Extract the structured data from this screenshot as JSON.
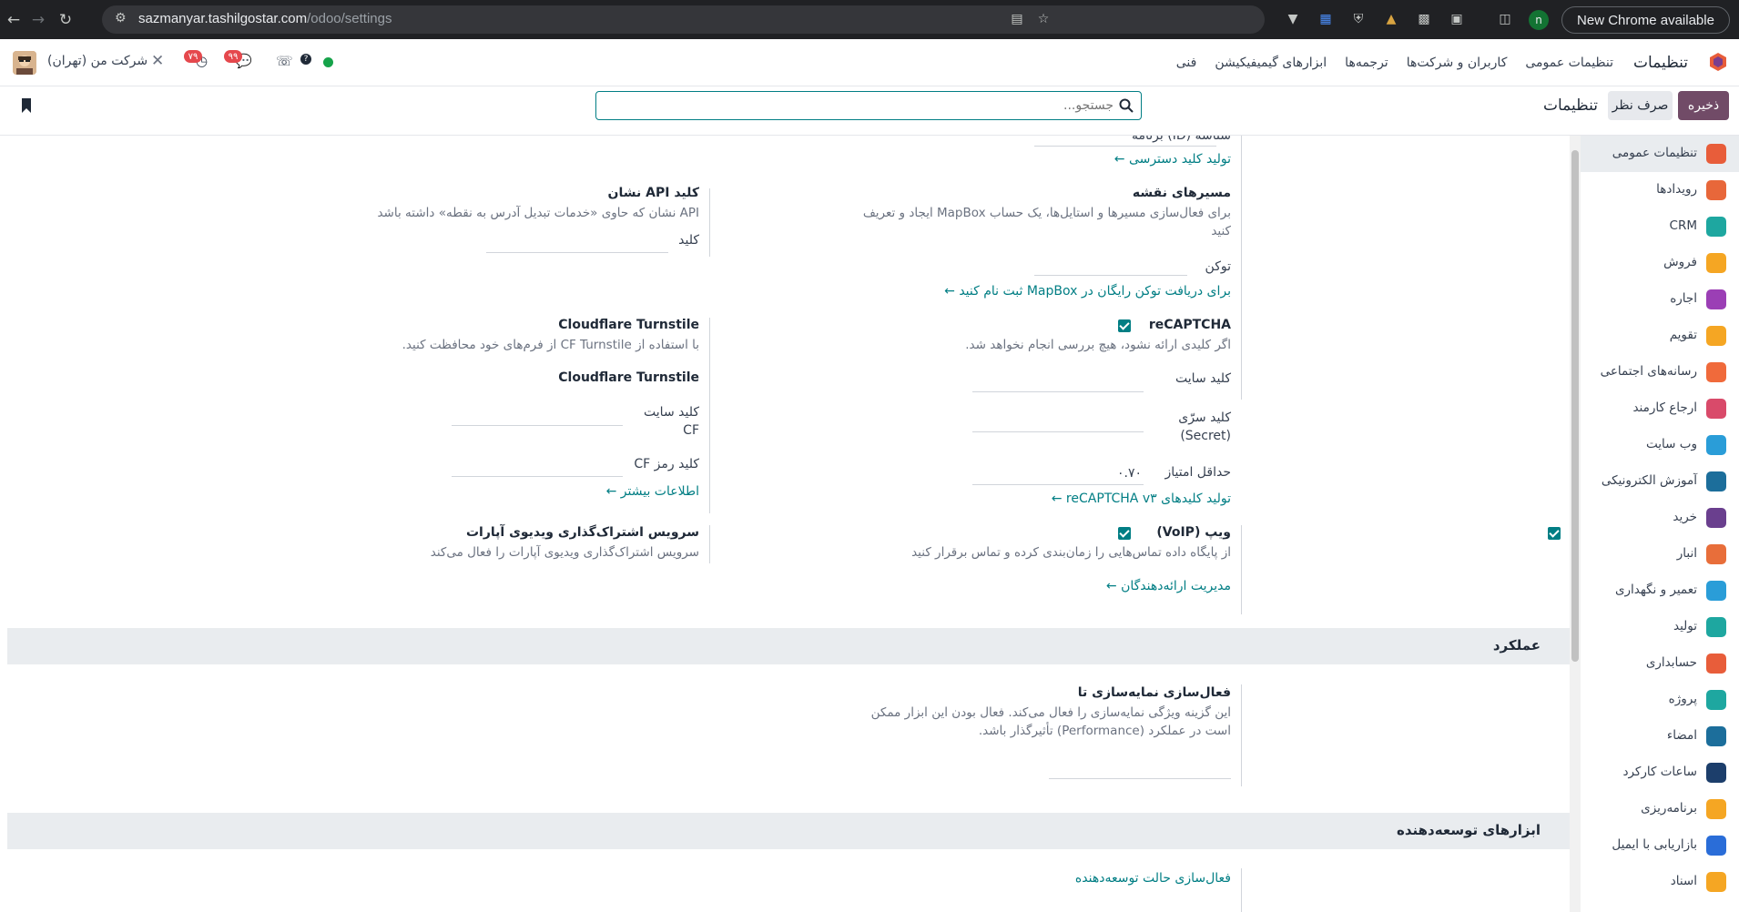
{
  "browser": {
    "url_host": "sazmanyar.tashilgostar.com",
    "url_path": "/odoo/settings",
    "new_chrome": "New Chrome available",
    "profile_initial": "n"
  },
  "navbar": {
    "app_name": "تنظیمات",
    "menus": [
      "تنظیمات عمومی",
      "کاربران و شرکت‌ها",
      "ترجمه‌ها",
      "ابزارهای گیمیفیکیشن",
      "فنی"
    ],
    "company": "شرکت من (تهران)",
    "activity_badge": "۷۹",
    "messages_badge": "۹۹"
  },
  "control_panel": {
    "save": "ذخیره",
    "discard": "صرف نظر",
    "title": "تنظیمات",
    "search_placeholder": "جستجو..."
  },
  "sidebar": {
    "items": [
      {
        "label": "تنظیمات عمومی",
        "icon": "settings-icon",
        "color": "#e85d3a"
      },
      {
        "label": "رویدادها",
        "icon": "events-icon",
        "color": "#e8673a"
      },
      {
        "label": "CRM",
        "icon": "crm-icon",
        "color": "#1ea7a0"
      },
      {
        "label": "فروش",
        "icon": "sales-icon",
        "color": "#f5a623"
      },
      {
        "label": "اجاره",
        "icon": "rental-icon",
        "color": "#9b3fb5"
      },
      {
        "label": "تقویم",
        "icon": "calendar-icon",
        "color": "#f5a623"
      },
      {
        "label": "رسانه‌های اجتماعی",
        "icon": "social-icon",
        "color": "#f06a3b"
      },
      {
        "label": "ارجاع کارمند",
        "icon": "referral-icon",
        "color": "#d94a6a"
      },
      {
        "label": "وب سایت",
        "icon": "website-icon",
        "color": "#2a9dd8"
      },
      {
        "label": "آموزش الکترونیکی",
        "icon": "elearning-icon",
        "color": "#1c6e9b"
      },
      {
        "label": "خرید",
        "icon": "purchase-icon",
        "color": "#6a3f8e"
      },
      {
        "label": "انبار",
        "icon": "inventory-icon",
        "color": "#e86e3a"
      },
      {
        "label": "تعمیر و نگهداری",
        "icon": "maintenance-icon",
        "color": "#2a9dd8"
      },
      {
        "label": "تولید",
        "icon": "manufacturing-icon",
        "color": "#1ea7a0"
      },
      {
        "label": "حسابداری",
        "icon": "accounting-icon",
        "color": "#e85d3a"
      },
      {
        "label": "پروژه",
        "icon": "project-icon",
        "color": "#1ea7a0"
      },
      {
        "label": "امضاء",
        "icon": "sign-icon",
        "color": "#1c6e9b"
      },
      {
        "label": "ساعات کارکرد",
        "icon": "timesheet-icon",
        "color": "#1c3e6b"
      },
      {
        "label": "برنامه‌ریزی",
        "icon": "planning-icon",
        "color": "#f5a623"
      },
      {
        "label": "بازاریابی با ایمیل",
        "icon": "email-marketing-icon",
        "color": "#2a6dd8"
      },
      {
        "label": "اسناد",
        "icon": "documents-icon",
        "color": "#f5a623"
      }
    ]
  },
  "settings": {
    "app_id_partial": "شناسه (ID) برنامه",
    "generate_access_key": "تولید کلید دسترسی",
    "map_routes_title": "مسیرهای نقشه",
    "map_routes_desc_1": "برای فعال‌سازی مسیرها و استایل‌ها، یک حساب MapBox ایجاد و تعریف",
    "map_routes_desc_2": "کنید",
    "token_label": "توکن",
    "mapbox_signup": "برای دریافت توکن رایگان در MapBox ثبت نام کنید",
    "geo_api_title": "کلید API نشان",
    "geo_api_desc": "API نشان که حاوی «خدمات تبدیل آدرس به نقطه» داشته باشد",
    "key_label": "کلید",
    "recaptcha_title": "reCAPTCHA",
    "recaptcha_desc": "اگر کلیدی ارائه نشود، هیچ بررسی انجام نخواهد شد.",
    "site_key": "کلید سایت",
    "secret_key_1": "کلید سرّی",
    "secret_key_2": "(Secret)",
    "min_score": "حداقل امتیاز",
    "min_score_value": "۰.۷۰",
    "generate_recaptcha": "تولید کلیدهای reCAPTCHA v۳",
    "turnstile_title": "Cloudflare Turnstile",
    "turnstile_desc": "با استفاده از CF Turnstile از فرم‌های خود محافظت کنید.",
    "turnstile_sub": "Cloudflare Turnstile",
    "cf_site_key_1": "کلید سایت",
    "cf_site_key_2": "CF",
    "cf_secret_key": "کلید رمز CF",
    "more_info": "اطلاعات بیشتر",
    "voip_title": "ویپ (VoIP)",
    "voip_desc": "از پایگاه داده تماس‌هایی را زمان‌بندی کرده و تماس برقرار کنید",
    "manage_providers": "مدیریت ارائه‌دهندگان",
    "aparat_title": "سرویس اشتراک‌گذاری ویدیوی آپارات",
    "aparat_desc": "سرویس اشتراک‌گذاری ویدیوی آپارات را فعال می‌کند",
    "perf_section": "عملکرد",
    "profiling_title": "فعال‌سازی نمایه‌سازی تا",
    "profiling_desc_1": "این گزینه ویژگی نمایه‌سازی را فعال می‌کند. فعال بودن این ابزار ممکن",
    "profiling_desc_2": "است در عملکرد (Performance) تأثیرگذار باشد.",
    "dev_section": "ابزارهای توسعه‌دهنده",
    "dev_mode": "فعال‌سازی حالت توسعه‌دهنده"
  }
}
